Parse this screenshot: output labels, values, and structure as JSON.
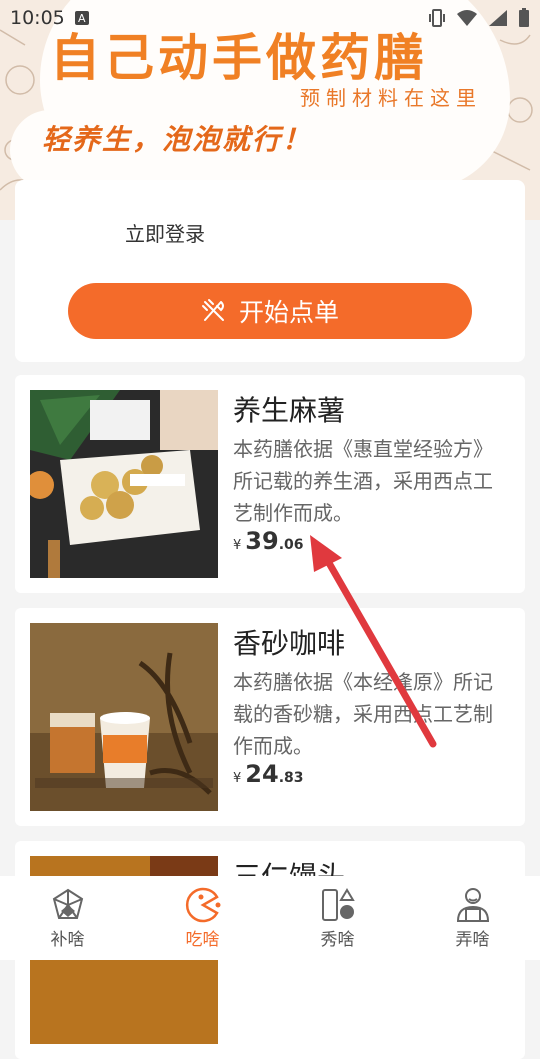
{
  "status_bar": {
    "time": "10:05",
    "notification_badge": "A"
  },
  "banner": {
    "title": "自己动手做药膳",
    "subtitle": "预制材料在这里",
    "slogan": "轻养生，泡泡就行！"
  },
  "login": {
    "login_text": "立即登录",
    "order_button_label": "开始点单"
  },
  "products": [
    {
      "title": "养生麻薯",
      "description": "本药膳依据《惠直堂经验方》所记载的养生酒，采用西点工艺制作而成。",
      "price_symbol": "¥",
      "price_integer": "39",
      "price_decimal": ".06"
    },
    {
      "title": "香砂咖啡",
      "description": "本药膳依据《本经逢原》所记载的香砂糖，采用西点工艺制作而成。",
      "price_symbol": "¥",
      "price_integer": "24",
      "price_decimal": ".83"
    },
    {
      "title": "三仁馒头"
    }
  ],
  "bottom_nav": [
    {
      "label": "补啥",
      "icon": "nutrition-icon",
      "active": false
    },
    {
      "label": "吃啥",
      "icon": "pacman-icon",
      "active": true
    },
    {
      "label": "秀啥",
      "icon": "shapes-icon",
      "active": false
    },
    {
      "label": "弄啥",
      "icon": "chef-icon",
      "active": false
    }
  ],
  "colors": {
    "accent": "#f46b2a",
    "banner_title": "#f08024",
    "arrow": "#e0393e"
  }
}
